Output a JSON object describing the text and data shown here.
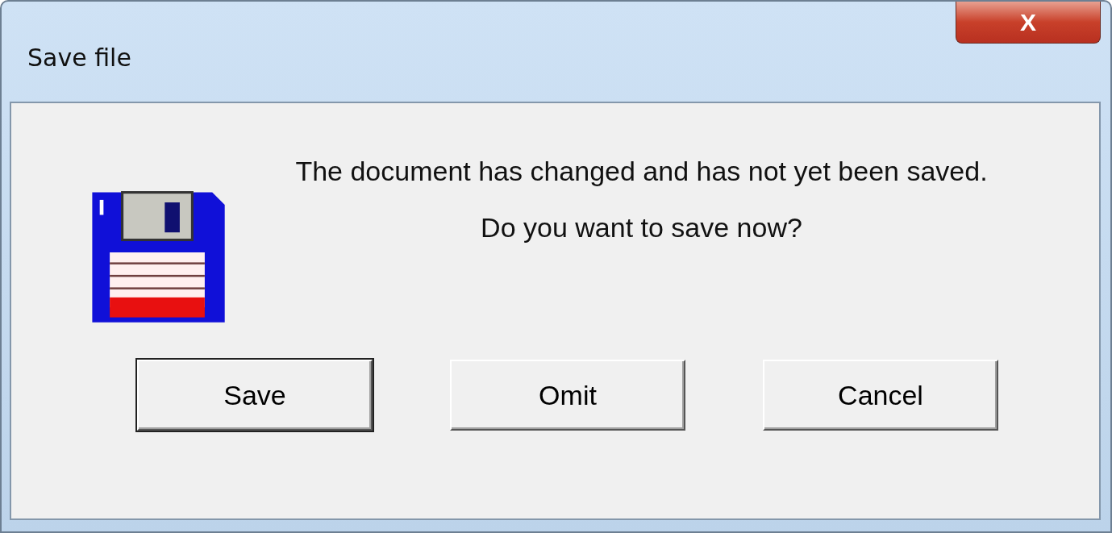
{
  "window": {
    "title": "Save file",
    "close_label": "X"
  },
  "message": {
    "lines": [
      "The document has changed and has not yet been saved.",
      "Do you want to save now?"
    ]
  },
  "buttons": [
    {
      "label": "Save",
      "default": true
    },
    {
      "label": "Omit",
      "default": false
    },
    {
      "label": "Cancel",
      "default": false
    }
  ]
}
